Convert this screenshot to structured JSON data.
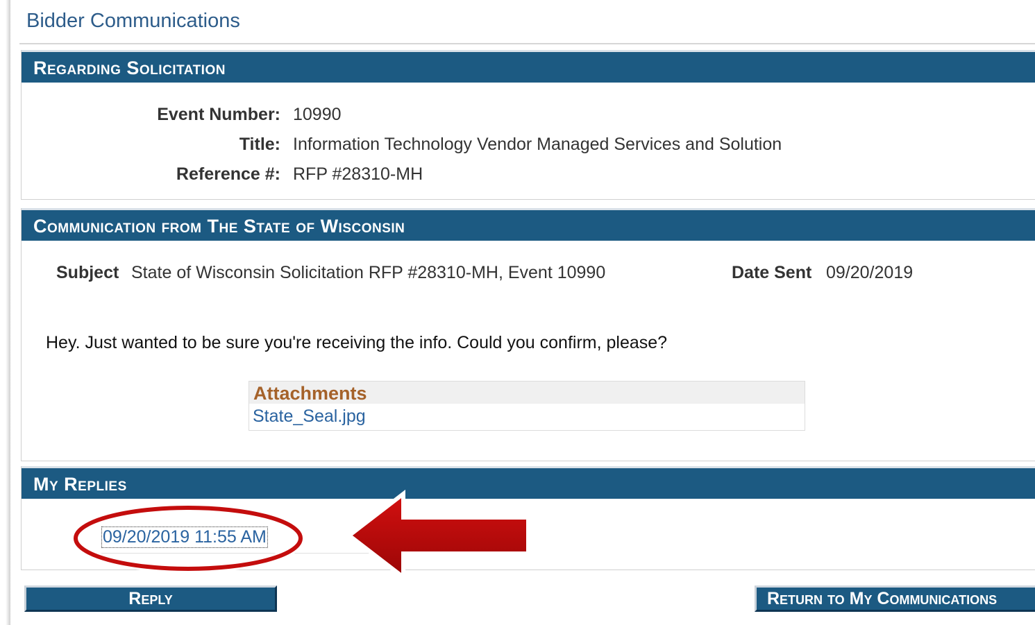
{
  "page": {
    "title": "Bidder Communications"
  },
  "solicitation": {
    "header": "Regarding Solicitation",
    "event_number_label": "Event Number:",
    "event_number_value": "10990",
    "title_label": "Title:",
    "title_value": "Information Technology Vendor Managed Services and Solution",
    "reference_label": "Reference #:",
    "reference_value": "RFP #28310-MH"
  },
  "communication": {
    "header": "Communication from The State of Wisconsin",
    "subject_label": "Subject",
    "subject_value": "State of Wisconsin Solicitation RFP #28310-MH, Event 10990",
    "date_sent_label": "Date Sent",
    "date_sent_value": "09/20/2019",
    "message": "Hey.  Just wanted to be sure you're receiving the info.  Could you confirm, please?",
    "attachments_header": "Attachments",
    "attachments": [
      "State_Seal.jpg"
    ]
  },
  "replies": {
    "header": "My Replies",
    "items": [
      "09/20/2019 11:55 AM"
    ]
  },
  "buttons": {
    "reply_label": "Reply",
    "return_label": "Return to My Communications"
  },
  "colors": {
    "header_bg": "#1c5a82",
    "link": "#2a63a0",
    "attachments_title": "#a5622a",
    "annotation": "#c40d0d"
  },
  "annotations": {
    "highlight_shapes": [
      "red-ellipse",
      "red-arrow-left"
    ]
  }
}
